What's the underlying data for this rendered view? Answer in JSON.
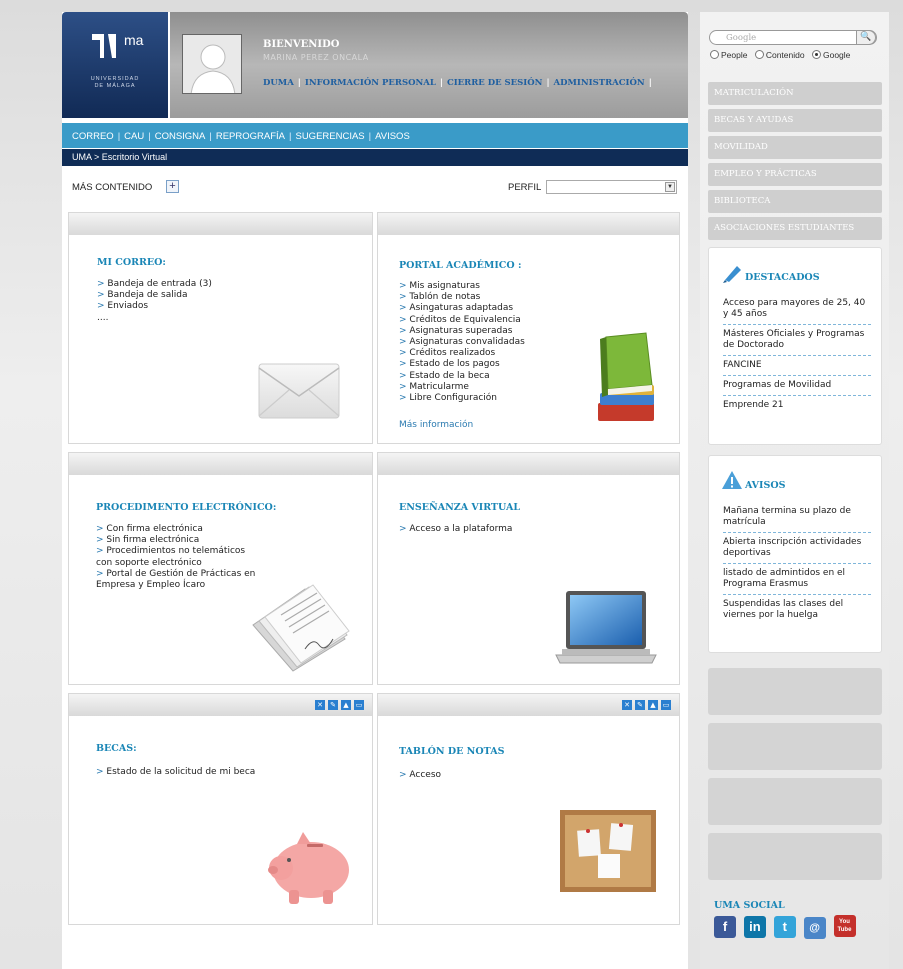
{
  "header": {
    "logo_text": "ma",
    "logo_university": "UNIVERSIDAD",
    "logo_city": "DE MÁLAGA",
    "welcome": "BIENVENIDO",
    "username": "MARINA PEREZ ONCALA",
    "links": [
      "DUMA",
      "INFORMACIÓN PERSONAL",
      "CIERRE DE SESIÓN",
      "ADMINISTRACIÓN"
    ]
  },
  "topnav": [
    "CORREO",
    "CAU",
    "CONSIGNA",
    "REPROGRAFÍA",
    "SUGERENCIAS",
    "AVISOS"
  ],
  "breadcrumb": "UMA >  Escritorio Virtual",
  "contentbar": {
    "more_content": "MÁS CONTENIDO",
    "plus": "+",
    "perfil": "PERFIL"
  },
  "panels": {
    "correo": {
      "title": "MI CORREO:",
      "items": [
        "Bandeja de entrada (3)",
        "Bandeja de salida",
        "Enviados"
      ],
      "ellipsis": "...."
    },
    "portal": {
      "title": "PORTAL ACADÉMICO :",
      "items": [
        "Mis asignaturas",
        "Tablón de notas",
        "Asingaturas adaptadas",
        "Créditos de Equivalencia",
        "Asignaturas superadas",
        "Asignaturas convalidadas",
        "Créditos realizados",
        "Estado de los pagos",
        "Estado de la beca",
        "Matricularme",
        "Libre Configuración"
      ],
      "more": "Más información"
    },
    "procedimiento": {
      "title": "PROCEDIMENTO ELECTRÓNICO:",
      "items": [
        "Con firma electrónica",
        "Sin firma electrónica",
        "Procedimientos no telemáticos",
        "Portal de Gestión de Prácticas en"
      ],
      "cont1": "con soporte electrónico",
      "cont2": "Empresa y Empleo Ícaro"
    },
    "ensenanza": {
      "title": "ENSEÑANZA VIRTUAL",
      "items": [
        "Acceso a la plataforma"
      ]
    },
    "becas": {
      "title": "BECAS:",
      "items": [
        "Estado de la solicitud de mi beca"
      ]
    },
    "tablon": {
      "title": "TABLÓN DE NOTAS",
      "items": [
        "Acceso"
      ]
    },
    "tools": [
      "✕",
      "✎",
      "▲",
      "▭"
    ]
  },
  "sidebar": {
    "search_placeholder": "Google",
    "search_button": "🔍",
    "radios": [
      {
        "label": "People",
        "checked": false
      },
      {
        "label": "Contenido",
        "checked": false
      },
      {
        "label": "Google",
        "checked": true
      }
    ],
    "menu": [
      "MATRICULACIÓN",
      "BECAS Y AYUDAS",
      "MOVILIDAD",
      "EMPLEO Y PRÁCTICAS",
      "BIBLIOTECA",
      "ASOCIACIONES ESTUDIANTES"
    ],
    "destacados": {
      "title": "DESTACADOS",
      "items": [
        "Acceso para mayores de 25, 40 y 45 años",
        "Másteres Oficiales y Programas de Doctorado",
        "FANCINE",
        "Programas de Movilidad",
        "Emprende 21"
      ]
    },
    "avisos": {
      "title": "AVISOS",
      "items": [
        "Mañana termina su plazo de matrícula",
        "Abierta inscripción actividades deportivas",
        "listado de admintidos en el Programa Erasmus",
        "Suspendidas las clases del viernes por la huelga"
      ]
    },
    "social_title": "UMA SOCIAL",
    "social": [
      "f",
      "in",
      "t",
      "@",
      "You Tube"
    ]
  },
  "colors": {
    "accent": "#3a9bc8",
    "navy": "#0f2c56",
    "title_blue": "#1a86b6"
  }
}
